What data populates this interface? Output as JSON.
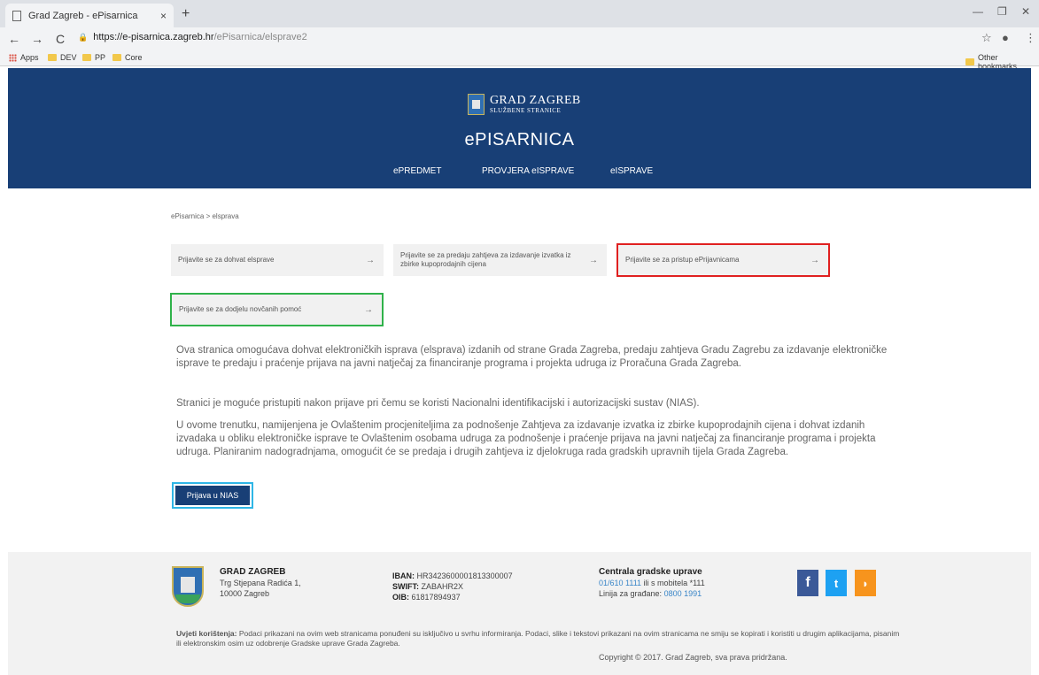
{
  "browser": {
    "tab_title": "Grad Zagreb - ePisarnica",
    "tab_close": "×",
    "new_tab": "+",
    "url_host": "https://e-pisarnica.zagreb.hr",
    "url_path": "/ePisarnica/elsprave2",
    "bookmarks": [
      "Apps",
      "DEV",
      "PP",
      "Core"
    ],
    "other_bookmarks": "Other bookmarks"
  },
  "header": {
    "logo_title": "GRAD ZAGREB",
    "logo_sub": "SLUŽBENE STRANICE",
    "app_title": "ePISARNICA",
    "nav": [
      "ePREDMET",
      "PROVJERA eISPRAVE",
      "eISPRAVE"
    ]
  },
  "breadcrumb": "ePisarnica > elsprava",
  "cards": [
    "Prijavite se za dohvat elsprave",
    "Prijavite se za predaju zahtjeva za izdavanje izvatka iz zbirke kupoprodajnih cijena",
    "Prijavite se za pristup ePrijavnicama",
    "Prijavite se za dodjelu novčanih pomoć"
  ],
  "card_arrow": "→",
  "paragraphs": [
    "Ova stranica omogućava dohvat elektroničkih isprava (elsprava) izdanih od strane Grada Zagreba, predaju zahtjeva Gradu Zagrebu za izdavanje elektroničke isprave te predaju i praćenje prijava na javni natječaj za financiranje programa i projekta udruga iz Proračuna Grada Zagreba.",
    "Stranici je moguće pristupiti nakon prijave pri čemu se koristi Nacionalni identifikacijski i autorizacijski sustav (NIAS).",
    "U ovome trenutku, namijenjena je Ovlaštenim procjeniteljima za podnošenje Zahtjeva za izdavanje izvatka iz zbirke kupoprodajnih cijena i dohvat izdanih izvadaka u obliku elektroničke isprave te Ovlaštenim osobama udruga za podnošenje i praćenje prijava na javni natječaj za financiranje programa i projekta udruga. Planiranim nadogradnjama, omogućit će se predaja i drugih zahtjeva iz djelokruga rada gradskih upravnih tijela Grada Zagreba."
  ],
  "nias_button": "Prijava u NIAS",
  "footer": {
    "org_name": "GRAD ZAGREB",
    "address1": "Trg Stjepana Radića 1,",
    "address2": "10000 Zagreb",
    "iban_label": "IBAN:",
    "iban": "HR3423600001813300007",
    "swift_label": "SWIFT:",
    "swift": "ZABAHR2X",
    "oib_label": "OIB:",
    "oib": "61817894937",
    "central_title": "Centrala gradske uprave",
    "central_phone": "01/610 1111",
    "central_mobile": "ili s mobitela *111",
    "citizens_label": "Linija za građane:",
    "citizens_phone": "0800 1991",
    "terms_label": "Uvjeti korištenja:",
    "terms_text": "Podaci prikazani na ovim web stranicama ponuđeni su isključivo u svrhu informiranja. Podaci, slike i tekstovi prikazani na ovim stranicama ne smiju se kopirati i koristiti u drugim aplikacijama, pisanim ili elektronskim osim uz odobrenje Gradske uprave Grada Zagreba.",
    "copyright": "Copyright © 2017. Grad Zagreb, sva prava pridržana."
  },
  "colors": {
    "header_bg": "#183f76",
    "red_highlight": "#e02020",
    "green_highlight": "#2fb24a",
    "facebook": "#3b5998",
    "twitter": "#1da1f2",
    "rss": "#f7941d"
  }
}
